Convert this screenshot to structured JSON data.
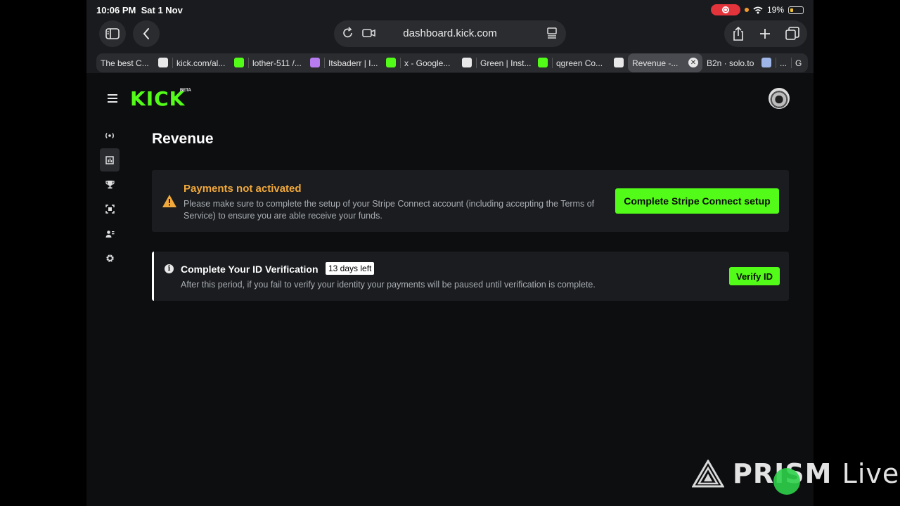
{
  "status_bar": {
    "time": "10:06 PM",
    "date": "Sat 1 Nov",
    "battery": "19%"
  },
  "browser": {
    "url": "dashboard.kick.com",
    "tabs": [
      {
        "label": "The best C...",
        "favicon": "shield-icon",
        "favicon_color": "#e8e8e8"
      },
      {
        "label": "kick.com/al...",
        "favicon": "kick-logo-icon",
        "favicon_color": "#53fc18"
      },
      {
        "label": "lother-511 /...",
        "favicon": "user-icon",
        "favicon_color": "#b67cf0"
      },
      {
        "label": "Itsbaderr | I...",
        "favicon": "plant-icon",
        "favicon_color": "#53fc18"
      },
      {
        "label": "x - Google...",
        "favicon": "google-icon",
        "favicon_color": "#e8e8e8"
      },
      {
        "label": "Green | Inst...",
        "favicon": "plant-icon",
        "favicon_color": "#53fc18"
      },
      {
        "label": "qgreen Co...",
        "favicon": "shield-icon",
        "favicon_color": "#e8e8e8"
      },
      {
        "label": "Revenue -...",
        "favicon": "close-icon",
        "favicon_color": "#e8e8e8",
        "active": true
      },
      {
        "label": "B2n · solo.to",
        "favicon": "bear-icon",
        "favicon_color": "#9fb6e8"
      },
      {
        "label": "...",
        "favicon": "",
        "favicon_color": ""
      },
      {
        "label": "G",
        "favicon": "",
        "favicon_color": ""
      }
    ]
  },
  "kick": {
    "logo": "KICK",
    "beta": "BETA",
    "sidebar_icons": [
      "broadcast-icon",
      "analytics-icon",
      "trophy-icon",
      "capture-icon",
      "community-icon",
      "settings-icon"
    ],
    "page_title": "Revenue",
    "payments_alert": {
      "title": "Payments not activated",
      "description": "Please make sure to complete the setup of your Stripe Connect account (including accepting the Terms of Service) to ensure you are able receive your funds.",
      "button": "Complete Stripe Connect setup"
    },
    "id_verification": {
      "title": "Complete Your ID Verification",
      "badge": "13 days left",
      "description": "After this period, if you fail to verify your identity your payments will be paused until verification is complete.",
      "button": "Verify ID"
    }
  },
  "watermark": {
    "text_bold": "PRISM",
    "text_light": "Live"
  },
  "colors": {
    "brand_green": "#53fc18",
    "warning": "#f2a93b",
    "card_bg": "#1a1c1f",
    "page_bg": "#0d0e10"
  }
}
